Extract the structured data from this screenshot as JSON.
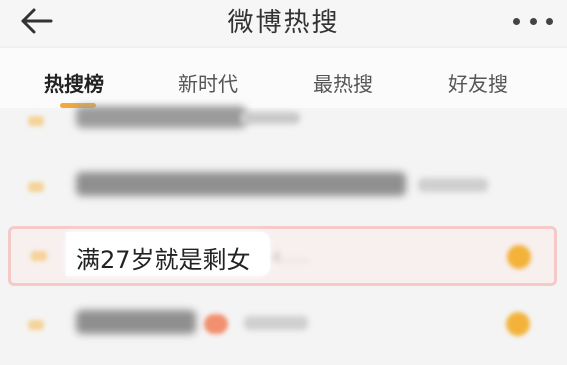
{
  "header": {
    "title": "微博热搜",
    "back_icon": "arrow-left-icon",
    "more_icon": "more-dots-icon"
  },
  "tabs": [
    {
      "label": "热搜榜",
      "active": true
    },
    {
      "label": "新时代",
      "active": false
    },
    {
      "label": "最热搜",
      "active": false
    },
    {
      "label": "好友搜",
      "active": false
    }
  ],
  "list": {
    "highlighted_item": {
      "text": "满27岁就是剩女",
      "count": "4……"
    }
  },
  "colors": {
    "accent": "#f2a93b",
    "highlight_border": "#f6c9c9",
    "hot_badge": "#f3b33a"
  }
}
